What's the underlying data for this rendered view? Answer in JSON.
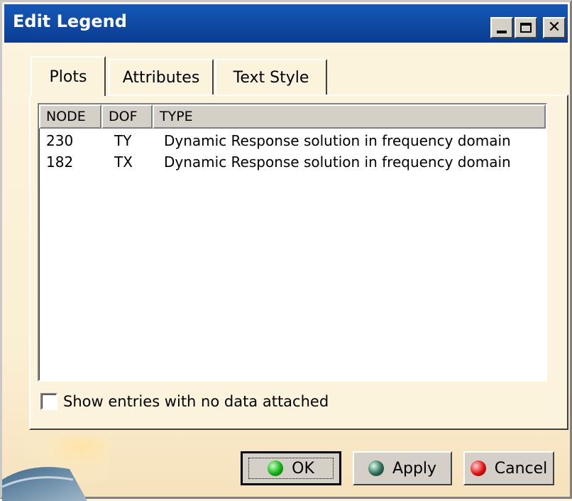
{
  "window": {
    "title": "Edit Legend"
  },
  "tabs": [
    {
      "label": "Plots",
      "active": true
    },
    {
      "label": "Attributes",
      "active": false
    },
    {
      "label": "Text Style",
      "active": false
    }
  ],
  "table": {
    "columns": [
      "NODE",
      "DOF",
      "TYPE"
    ],
    "rows": [
      {
        "node": "230",
        "dof": "TY",
        "type": "Dynamic Response solution in frequency domain"
      },
      {
        "node": "182",
        "dof": "TX",
        "type": "Dynamic Response solution in frequency domain"
      }
    ]
  },
  "checkbox": {
    "label": "Show entries with no data attached",
    "checked": false
  },
  "buttons": {
    "ok": "OK",
    "apply": "Apply",
    "cancel": "Cancel"
  },
  "colors": {
    "titlebar": "#0a3d91",
    "background": "#fcf3dc"
  }
}
